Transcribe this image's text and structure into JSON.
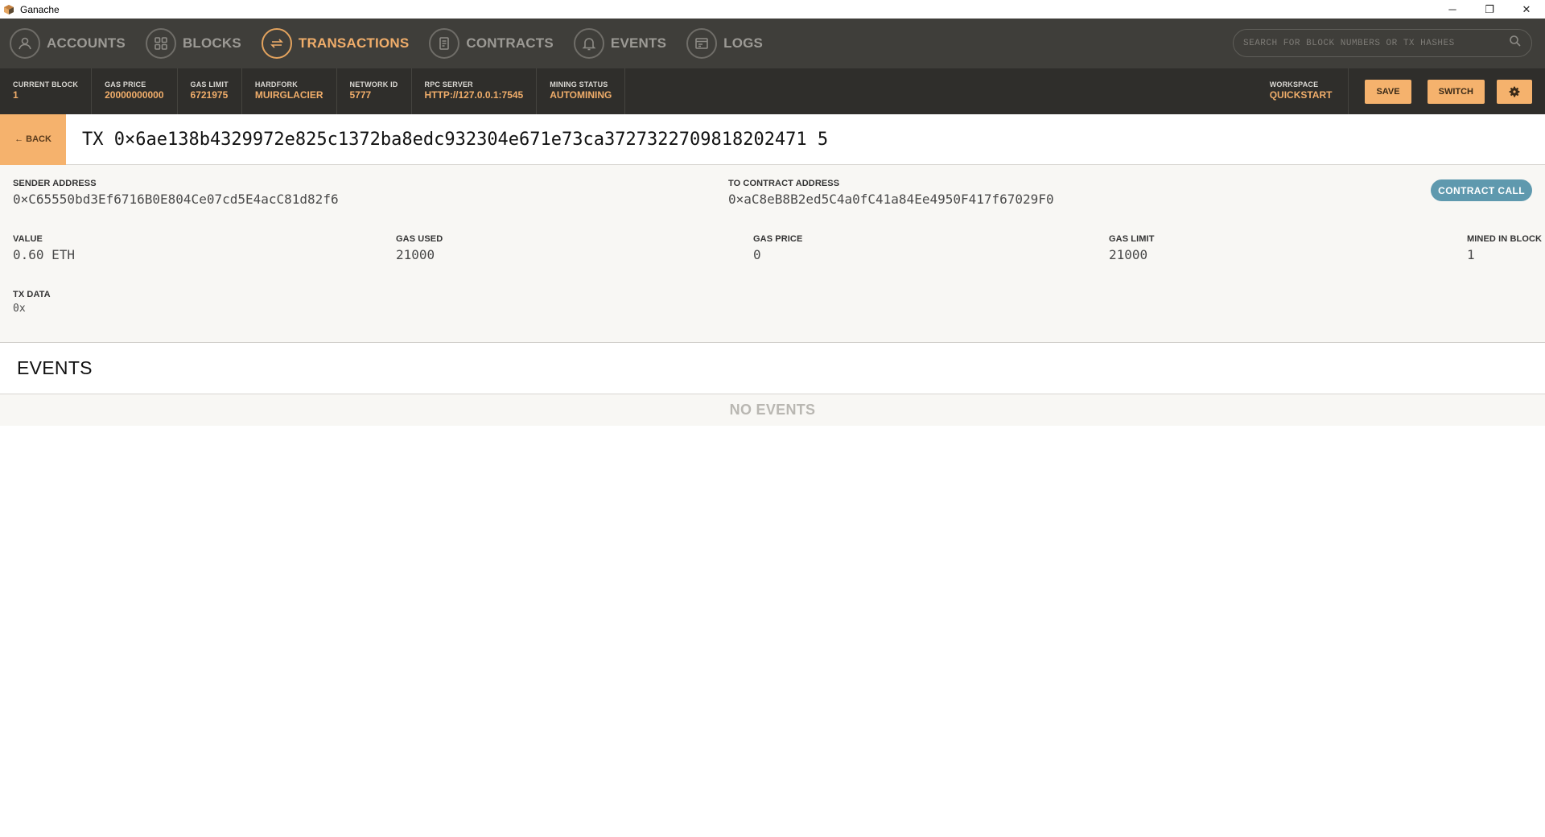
{
  "window": {
    "title": "Ganache",
    "minimize_glyph": "─",
    "maximize_glyph": "❐",
    "close_glyph": "✕"
  },
  "nav": {
    "items": [
      {
        "label": "ACCOUNTS",
        "icon": "person-icon",
        "active": false
      },
      {
        "label": "BLOCKS",
        "icon": "grid-icon",
        "active": false
      },
      {
        "label": "TRANSACTIONS",
        "icon": "arrows-swap-icon",
        "active": true
      },
      {
        "label": "CONTRACTS",
        "icon": "document-icon",
        "active": false
      },
      {
        "label": "EVENTS",
        "icon": "bell-icon",
        "active": false
      },
      {
        "label": "LOGS",
        "icon": "terminal-icon",
        "active": false
      }
    ],
    "search_placeholder": "SEARCH FOR BLOCK NUMBERS OR TX HASHES"
  },
  "status": {
    "current_block": {
      "label": "CURRENT BLOCK",
      "value": "1"
    },
    "gas_price": {
      "label": "GAS PRICE",
      "value": "20000000000"
    },
    "gas_limit": {
      "label": "GAS LIMIT",
      "value": "6721975"
    },
    "hardfork": {
      "label": "HARDFORK",
      "value": "MUIRGLACIER"
    },
    "network_id": {
      "label": "NETWORK ID",
      "value": "5777"
    },
    "rpc_server": {
      "label": "RPC SERVER",
      "value": "HTTP://127.0.0.1:7545"
    },
    "mining_status": {
      "label": "MINING STATUS",
      "value": "AUTOMINING"
    },
    "workspace": {
      "label": "WORKSPACE",
      "value": "QUICKSTART"
    },
    "save_label": "SAVE",
    "switch_label": "SWITCH"
  },
  "tx": {
    "back_label": "← BACK",
    "title": "TX 0×6ae138b4329972e825c1372ba8edc932304e671e73ca3727322709818202471 5",
    "sender_label": "SENDER ADDRESS",
    "sender_value": "0×C65550bd3Ef6716B0E804Ce07cd5E4acC81d82f6",
    "to_label": "TO CONTRACT ADDRESS",
    "to_value": "0×aC8eB8B2ed5C4a0fC41a84Ee4950F417f67029F0",
    "type_badge": "CONTRACT CALL",
    "value_label": "VALUE",
    "value_value": "0.60 ETH",
    "gas_used_label": "GAS USED",
    "gas_used_value": "21000",
    "gas_price_label": "GAS PRICE",
    "gas_price_value": "0",
    "gas_limit_label": "GAS LIMIT",
    "gas_limit_value": "21000",
    "mined_label": "MINED IN BLOCK",
    "mined_value": "1",
    "data_label": "TX DATA",
    "data_value": "0x"
  },
  "events": {
    "title": "EVENTS",
    "empty_label": "NO EVENTS"
  },
  "colors": {
    "accent": "#f0ad6a",
    "nav_bg": "#3f3e3a",
    "status_bg": "#2f2e2b",
    "badge": "#5f99ae"
  }
}
